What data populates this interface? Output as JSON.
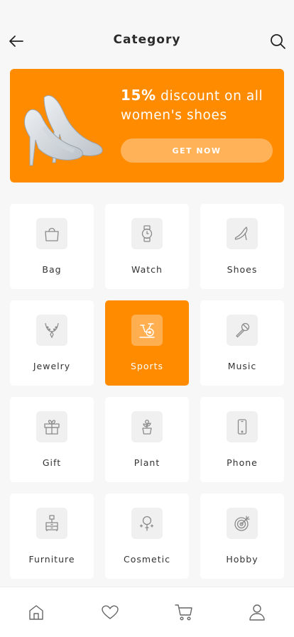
{
  "header": {
    "title": "Category",
    "back_icon": "arrow-left-icon",
    "search_icon": "search-icon"
  },
  "banner": {
    "text_bold": "15%",
    "text_rest": " discount on all women's shoes",
    "cta_label": "GET NOW",
    "bg_color": "#ff8c00",
    "cta_color": "#ffb257"
  },
  "categories": [
    {
      "label": "Bag",
      "icon": "bag-icon"
    },
    {
      "label": "Watch",
      "icon": "watch-icon"
    },
    {
      "label": "Shoes",
      "icon": "shoe-icon"
    },
    {
      "label": "Jewelry",
      "icon": "necklace-icon"
    },
    {
      "label": "Sports",
      "icon": "exercise-bike-icon",
      "selected": true
    },
    {
      "label": "Music",
      "icon": "microphone-icon"
    },
    {
      "label": "Gift",
      "icon": "gift-icon"
    },
    {
      "label": "Plant",
      "icon": "plant-icon"
    },
    {
      "label": "Phone",
      "icon": "phone-icon"
    },
    {
      "label": "Furniture",
      "icon": "nightstand-icon"
    },
    {
      "label": "Cosmetic",
      "icon": "mirror-icon"
    },
    {
      "label": "Hobby",
      "icon": "target-icon"
    }
  ],
  "tabbar": {
    "items": [
      "home-icon",
      "heart-icon",
      "cart-icon",
      "user-icon"
    ]
  },
  "colors": {
    "accent": "#ff8c00",
    "background": "#f7f7f7",
    "icon_stroke": "#8a8a8a"
  }
}
